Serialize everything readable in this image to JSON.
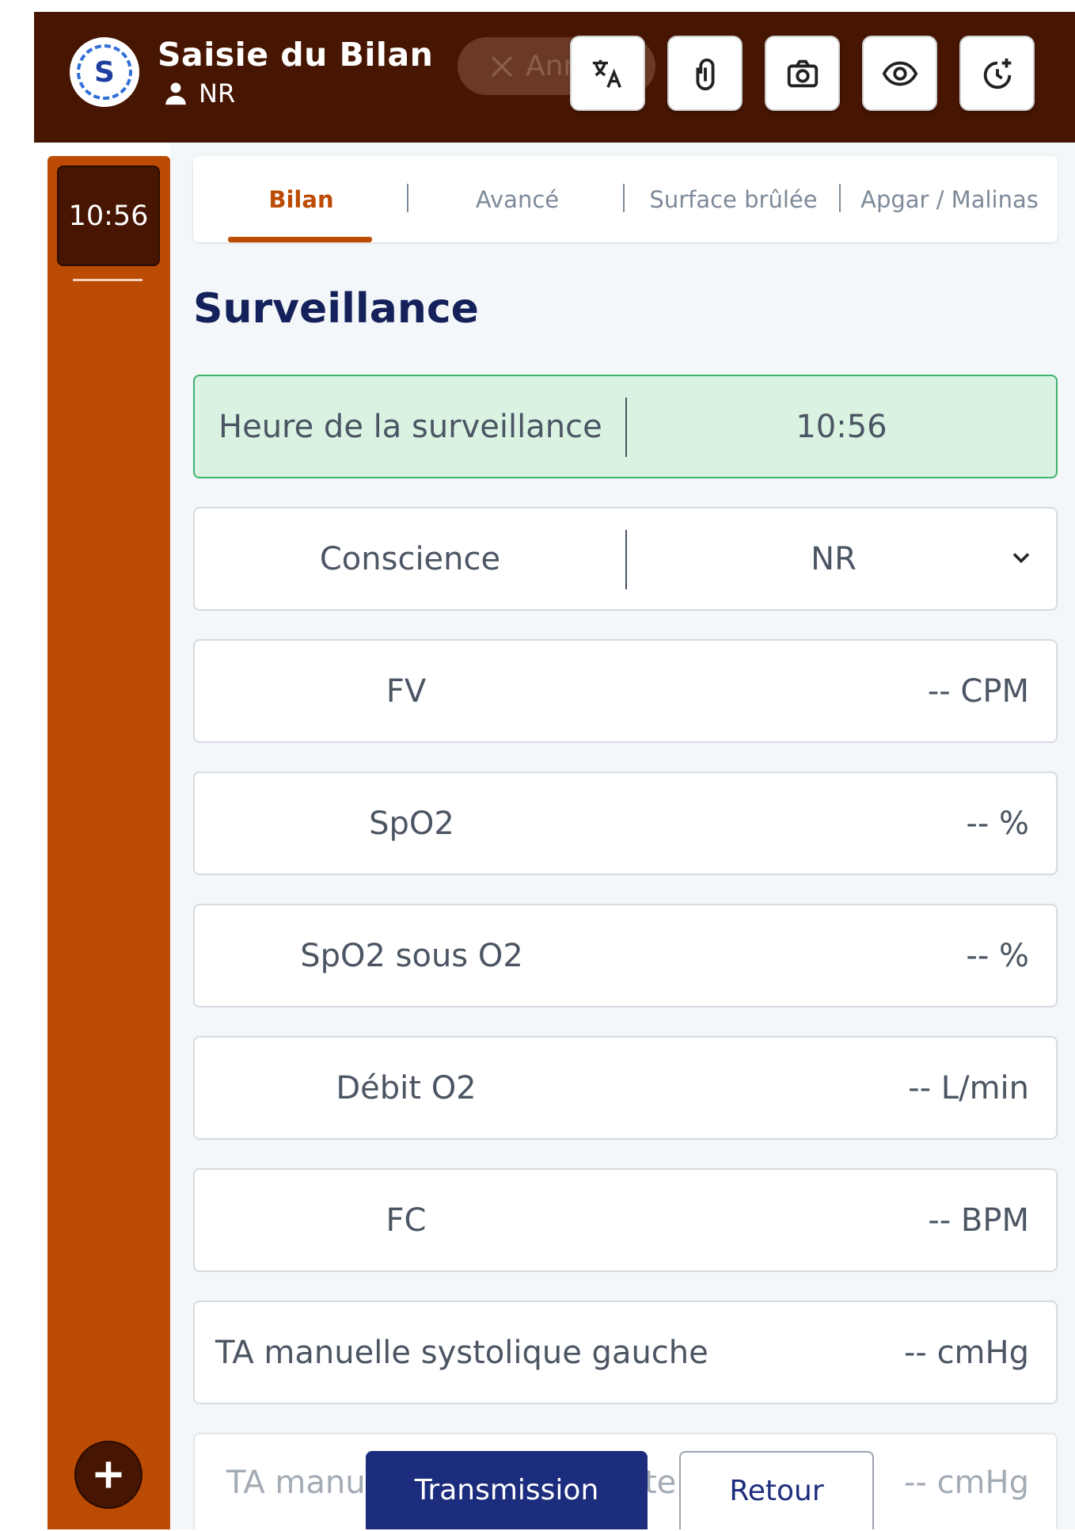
{
  "header": {
    "title": "Saisie du Bilan",
    "user": "NR",
    "cancel_label": "Annuler",
    "icons": [
      "translate-icon",
      "paperclip-icon",
      "camera-icon",
      "eye-icon",
      "clock-plus-icon"
    ],
    "colors": {
      "bar": "#471602",
      "accent": "#bc4b03",
      "primary": "#1d2d7d"
    }
  },
  "sidebar": {
    "time_slots": [
      "10:56"
    ]
  },
  "tabs": [
    {
      "label": "Bilan",
      "active": true
    },
    {
      "label": "Avancé",
      "active": false
    },
    {
      "label": "Surface brûlée",
      "active": false
    },
    {
      "label": "Apgar / Malinas",
      "active": false
    }
  ],
  "section": {
    "title": "Surveillance"
  },
  "fields": {
    "heure": {
      "label": "Heure de la surveillance",
      "value": "10:56"
    },
    "conscience": {
      "label": "Conscience",
      "value": "NR"
    },
    "fv": {
      "label": "FV",
      "value": "-- CPM"
    },
    "spo2": {
      "label": "SpO2",
      "value": "-- %"
    },
    "spo2_o2": {
      "label": "SpO2 sous O2",
      "value": "-- %"
    },
    "debit_o2": {
      "label": "Débit O2",
      "value": "-- L/min"
    },
    "fc": {
      "label": "FC",
      "value": "-- BPM"
    },
    "ta_sys_g": {
      "label": "TA manuelle systolique gauche",
      "value": "-- cmHg"
    },
    "ta_next": {
      "label_left": "TA manue",
      "label_right": "te",
      "value": "-- cmHg"
    }
  },
  "actions": {
    "transmission": "Transmission",
    "retour": "Retour"
  }
}
